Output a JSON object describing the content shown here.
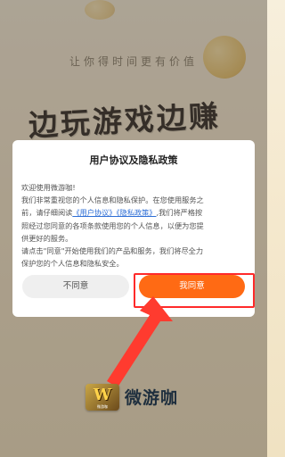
{
  "background": {
    "slogan": "让你得时间更有价值",
    "headline": "边玩游戏边赚钱"
  },
  "dialog": {
    "title": "用户协议及隐私政策",
    "lines": [
      "欢迎使用微游咖!",
      "我们非常重视您的个人信息和隐私保护。在您使用服务之",
      "前，请仔细阅读",
      "我们将严格按",
      "照经过您同意的各项条款使用您的个人信息，以便为您提",
      "供更好的服务。",
      "请点击\"同意\"开始使用我们的产品和服务，我们将尽全力",
      "保护您的个人信息和隐私安全。"
    ],
    "link_user_agreement": "《用户协议》",
    "link_privacy_policy": "《隐私政策》",
    "link_suffix": ",",
    "decline_label": "不同意",
    "accept_label": "我同意"
  },
  "brand": {
    "logo_letter": "W",
    "logo_subtext": "微游咖",
    "name": "微游咖"
  },
  "colors": {
    "accent": "#ff6a14",
    "link": "#2f6fd6",
    "highlight": "#ff2a2a"
  }
}
